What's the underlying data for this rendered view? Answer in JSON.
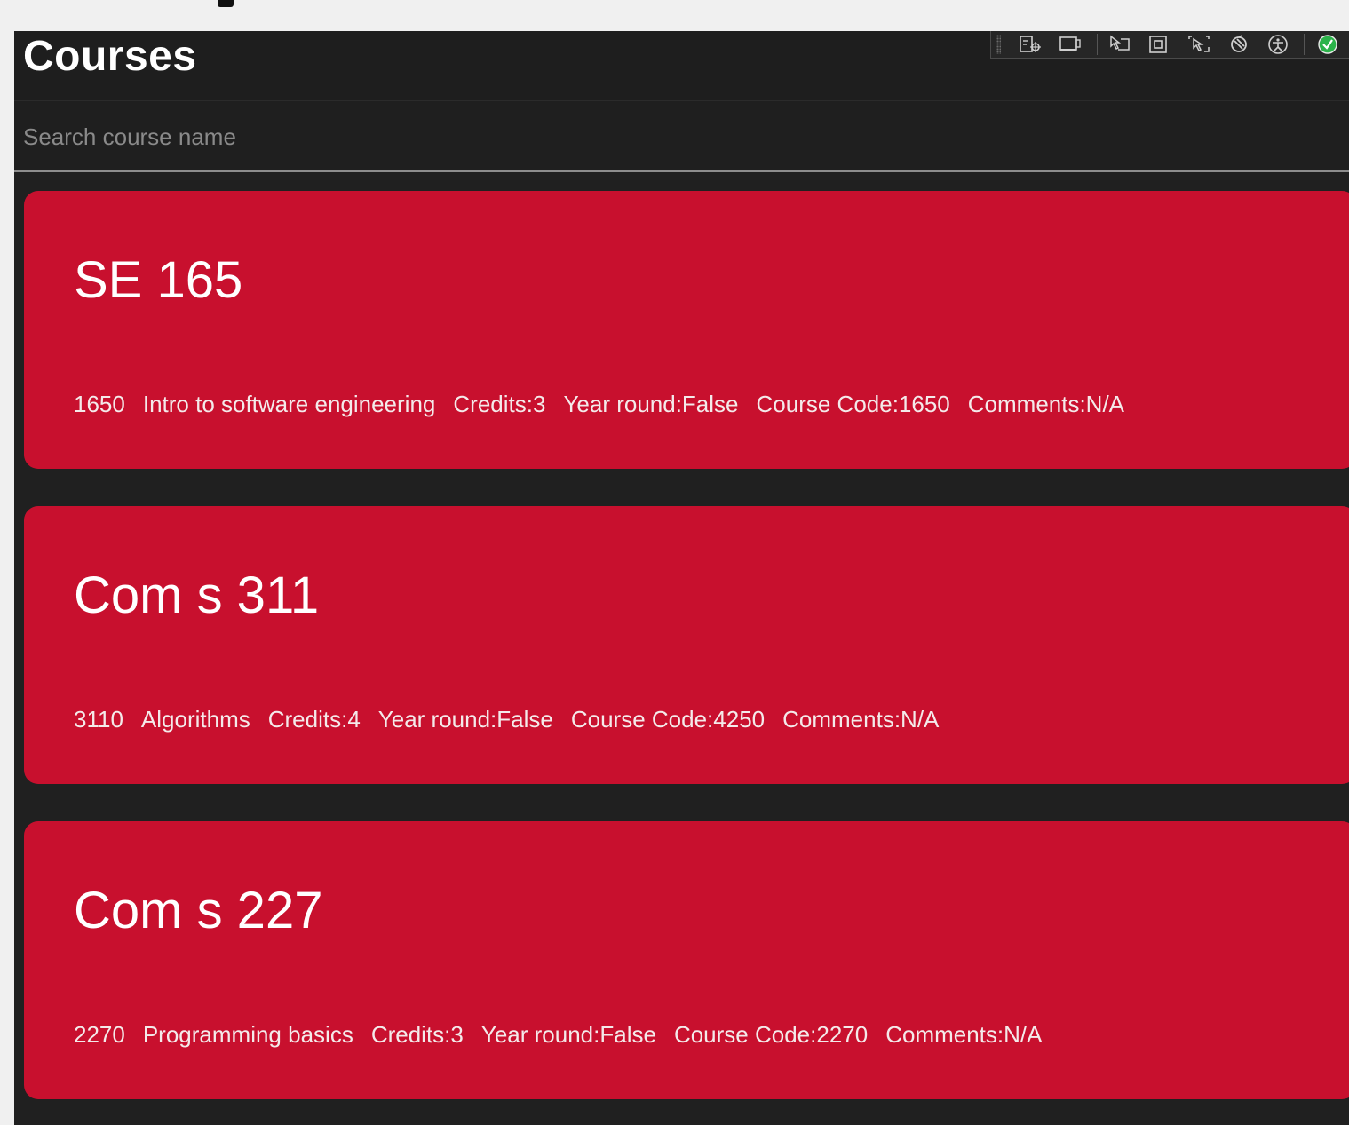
{
  "page": {
    "title": "Courses"
  },
  "devtools": {
    "icons": [
      "live-tree-icon",
      "display-layout-icon",
      "select-element-icon",
      "layout-adorners-icon",
      "track-focus-icon",
      "hot-reload-icon",
      "accessibility-icon",
      "binding-check-icon"
    ]
  },
  "search": {
    "placeholder": "Search course name",
    "value": ""
  },
  "courses": [
    {
      "name": "SE 165",
      "number": "1650",
      "description": "Intro to software engineering",
      "credits": "Credits:3",
      "year_round": "Year round:False",
      "course_code": "Course Code:1650",
      "comments": "Comments:N/A"
    },
    {
      "name": "Com s 311",
      "number": "3110",
      "description": "Algorithms",
      "credits": "Credits:4",
      "year_round": "Year round:False",
      "course_code": "Course Code:4250",
      "comments": "Comments:N/A"
    },
    {
      "name": "Com s 227",
      "number": "2270",
      "description": "Programming basics",
      "credits": "Credits:3",
      "year_round": "Year round:False",
      "course_code": "Course Code:2270",
      "comments": "Comments:N/A"
    }
  ],
  "colors": {
    "card": "#c8102e",
    "background": "#202020",
    "check_green": "#2bb34a"
  }
}
